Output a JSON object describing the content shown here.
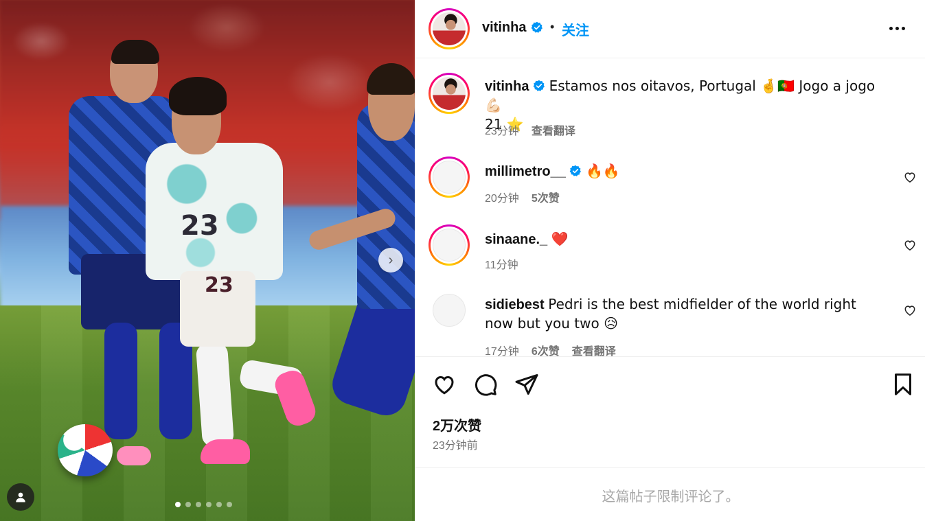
{
  "media": {
    "jersey_number_front": "23",
    "jersey_number_shorts": "23",
    "next_arrow_glyph": "›",
    "slide_count": 6,
    "active_slide": 1
  },
  "post_header": {
    "username": "vitinha",
    "verified": true,
    "separator": "•",
    "follow_label": "关注"
  },
  "caption": {
    "username": "vitinha",
    "text_line1": "Estamos nos oitavos, Portugal 🤞🇵🇹 Jogo a jogo 💪🏻",
    "text_line2": "21 ⭐",
    "time": "23分钟",
    "translate_label": "查看翻译"
  },
  "comments": [
    {
      "username": "millimetro__",
      "verified": true,
      "text": "🔥🔥",
      "time": "20分钟",
      "likes": "5次赞",
      "translate": ""
    },
    {
      "username": "sinaane._",
      "verified": false,
      "text": "❤️",
      "time": "11分钟",
      "likes": "",
      "translate": ""
    },
    {
      "username": "sidiebest",
      "verified": false,
      "text": "Pedri is the best midfielder of the world right now but you two 😥",
      "time": "17分钟",
      "likes": "6次赞",
      "translate": "查看翻译"
    }
  ],
  "actions": {
    "likes_count": "2万次赞",
    "posted_time": "23分钟前"
  },
  "comments_limited_notice": "这篇帖子限制评论了。",
  "colors": {
    "accent_blue": "#0095f6",
    "verified_blue": "#0095f6",
    "muted_text": "#737373",
    "notice_text": "#a8a8a8"
  },
  "icons": [
    "verified-badge-icon",
    "more-options-icon",
    "heart-icon",
    "comment-icon",
    "share-icon",
    "bookmark-icon",
    "next-arrow-icon",
    "user-tag-icon"
  ]
}
